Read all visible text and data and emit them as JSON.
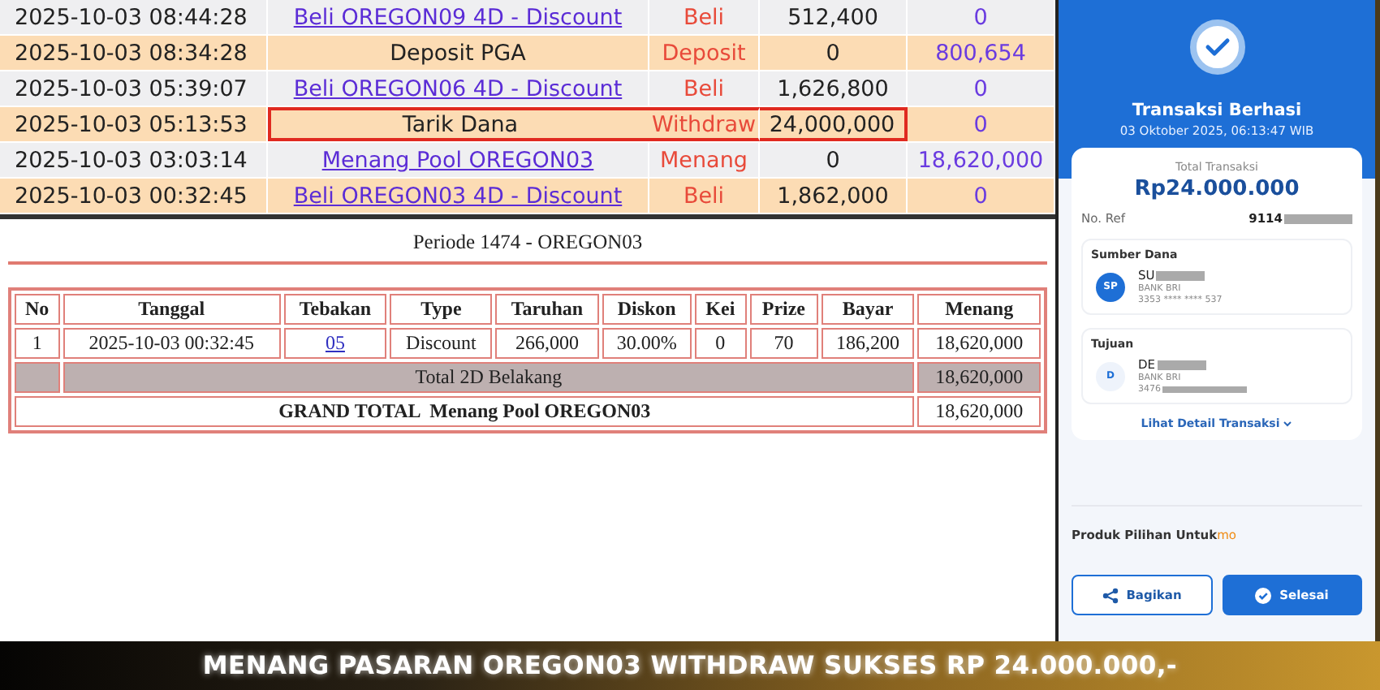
{
  "history": {
    "rows": [
      {
        "time": "2025-10-03 08:44:28",
        "description": "Beli OREGON09 4D - Discount",
        "link": true,
        "type": "Beli",
        "amount": "512,400",
        "balance": "0",
        "highlighted": false
      },
      {
        "time": "2025-10-03 08:34:28",
        "description": "Deposit PGA",
        "link": false,
        "type": "Deposit",
        "amount": "0",
        "balance": "800,654",
        "highlighted": false
      },
      {
        "time": "2025-10-03 05:39:07",
        "description": "Beli OREGON06 4D - Discount",
        "link": true,
        "type": "Beli",
        "amount": "1,626,800",
        "balance": "0",
        "highlighted": false
      },
      {
        "time": "2025-10-03 05:13:53",
        "description": "Tarik Dana",
        "link": false,
        "type": "Withdraw",
        "amount": "24,000,000",
        "balance": "0",
        "highlighted": true
      },
      {
        "time": "2025-10-03 03:03:14",
        "description": "Menang Pool OREGON03",
        "link": true,
        "type": "Menang",
        "amount": "0",
        "balance": "18,620,000",
        "highlighted": false
      },
      {
        "time": "2025-10-03 00:32:45",
        "description": "Beli OREGON03 4D - Discount",
        "link": true,
        "type": "Beli",
        "amount": "1,862,000",
        "balance": "0",
        "highlighted": false
      }
    ]
  },
  "period": {
    "title": "Periode 1474 - OREGON03",
    "columns": [
      "No",
      "Tanggal",
      "Tebakan",
      "Type",
      "Taruhan",
      "Diskon",
      "Kei",
      "Prize",
      "Bayar",
      "Menang"
    ],
    "rows": [
      [
        "1",
        "2025-10-03 00:32:45",
        "05",
        "Discount",
        "266,000",
        "30.00%",
        "0",
        "70",
        "186,200",
        "18,620,000"
      ]
    ],
    "subtotal": {
      "label": "Total 2D Belakang",
      "value": "18,620,000"
    },
    "grand_total": {
      "label": "GRAND TOTAL  Menang Pool OREGON03",
      "value": "18,620,000"
    }
  },
  "receipt": {
    "title": "Transaksi Berhasi",
    "datetime": "03 Oktober 2025, 06:13:47 WIB",
    "total_label": "Total Transaksi",
    "total": "Rp24.000.000",
    "ref_label": "No. Ref",
    "ref": "9114",
    "parties": [
      {
        "heading": "Sumber Dana",
        "initials": "SP",
        "filled": true,
        "name": "SU",
        "bank": "BANK BRI",
        "account": "3353 **** **** 537",
        "account_masked": false
      },
      {
        "heading": "Tujuan",
        "initials": "D",
        "filled": false,
        "name": "DE",
        "bank": "BANK BRI",
        "account": "3476",
        "account_masked": true
      }
    ],
    "detail_link": "Lihat Detail Transaksi",
    "promo": "Produk Pilihan Untuk",
    "promo_brand": "mo",
    "buttons": [
      {
        "label": "Bagikan",
        "kind": "outline"
      },
      {
        "label": "Selesai",
        "kind": "primary"
      }
    ]
  },
  "banner": "MENANG PASARAN OREGON03 WITHDRAW SUKSES RP 24.000.000,-"
}
